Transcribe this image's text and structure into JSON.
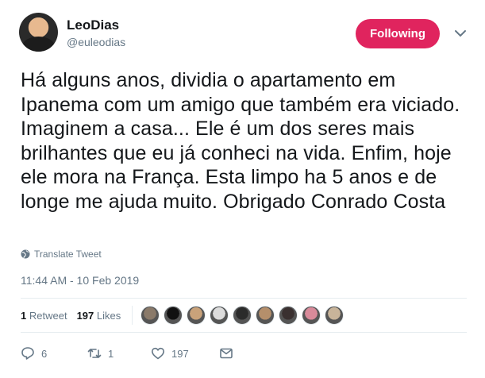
{
  "author": {
    "name": "LeoDias",
    "handle": "@euleodias"
  },
  "follow_button": {
    "label": "Following",
    "color": "#e0245e"
  },
  "tweet": {
    "text": "Há alguns anos, dividia o apartamento em Ipanema com um amigo que também era viciado. Imaginem a casa... Ele é um dos seres mais brilhantes que eu já conheci na vida. Enfim, hoje ele mora na França. Esta limpo ha 5 anos e de longe me ajuda muito. Obrigado Conrado Costa",
    "translate_label": "Translate Tweet",
    "timestamp": "11:44 AM - 10 Feb 2019"
  },
  "stats": {
    "retweets_count": "1",
    "retweets_label": "Retweet",
    "likes_count": "197",
    "likes_label": "Likes"
  },
  "liker_avatars": [
    {
      "color": "#8a7a6a"
    },
    {
      "color": "#111111"
    },
    {
      "color": "#c9a27a"
    },
    {
      "color": "#dcdcdc"
    },
    {
      "color": "#2b2b2b"
    },
    {
      "color": "#b58f6b"
    },
    {
      "color": "#3a3030"
    },
    {
      "color": "#d88a9a"
    },
    {
      "color": "#c8b49a"
    }
  ],
  "actions": {
    "reply_count": "6",
    "retweet_count": "1",
    "like_count": "197"
  },
  "icons": [
    "chevron-down-icon",
    "globe-icon",
    "reply-icon",
    "retweet-icon",
    "heart-icon",
    "envelope-icon"
  ]
}
